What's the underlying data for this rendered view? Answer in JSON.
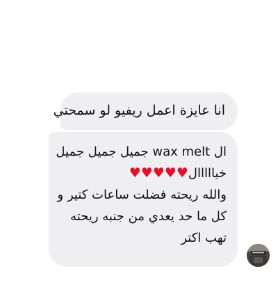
{
  "conversation": {
    "messages": [
      {
        "id": "msg-1",
        "lines": [
          "انا عايزة اعمل ريفيو لو سمحتي"
        ]
      },
      {
        "id": "msg-2",
        "line1": "ال wax melt جميل جميل جميل",
        "line2_text": "خيااااال",
        "line2_hearts": "♥♥♥♥♥",
        "line3": "والله ريحته فضلت ساعات كتير و",
        "line4": "كل ما حد يعدي من جنبه ريحته",
        "line5": "تهب اكتر"
      }
    ],
    "sender_avatar_icon": "profile-photo-icon"
  },
  "colors": {
    "bubble_background": "#efeff1",
    "text": "#111111",
    "heart": "#e0112b",
    "page_background": "#ffffff"
  }
}
